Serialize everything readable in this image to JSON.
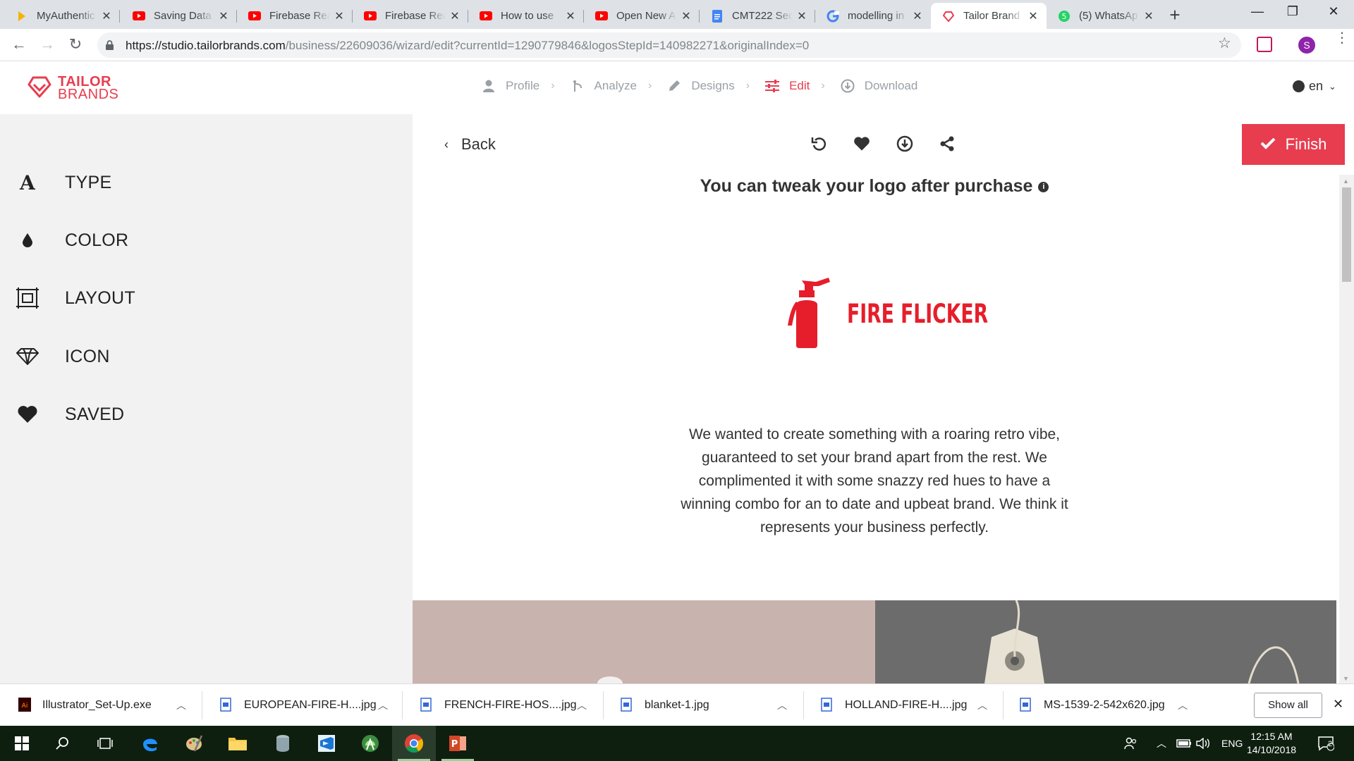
{
  "browser": {
    "tabs": [
      {
        "title": "MyAuthentic",
        "favicon": "myauthentic-icon",
        "color": "#f4b400"
      },
      {
        "title": "Saving Data",
        "favicon": "youtube-icon",
        "color": "#ff0000"
      },
      {
        "title": "Firebase Rea",
        "favicon": "youtube-icon",
        "color": "#ff0000"
      },
      {
        "title": "Firebase Rea",
        "favicon": "youtube-icon",
        "color": "#ff0000"
      },
      {
        "title": "How to use",
        "favicon": "youtube-icon",
        "color": "#ff0000"
      },
      {
        "title": "Open New A",
        "favicon": "youtube-icon",
        "color": "#ff0000"
      },
      {
        "title": "CMT222 Sec",
        "favicon": "docs-icon",
        "color": "#4285f4"
      },
      {
        "title": "modelling in",
        "favicon": "google-icon",
        "color": "#4285f4"
      },
      {
        "title": "Tailor Brand",
        "favicon": "tailorbrands-icon",
        "color": "#e73d4f",
        "active": true
      },
      {
        "title": "(5) WhatsAp",
        "favicon": "whatsapp-icon",
        "color": "#25d366"
      }
    ],
    "url_host": "https://studio.tailorbrands.com",
    "url_path": "/business/22609036/wizard/edit?currentId=1290779846&logosStepId=140982271&originalIndex=0",
    "profile_initial": "S"
  },
  "header": {
    "brand_line1": "TAILOR",
    "brand_line2": "BRANDS",
    "steps": [
      {
        "label": "Profile",
        "icon": "user-icon"
      },
      {
        "label": "Analyze",
        "icon": "analyze-icon"
      },
      {
        "label": "Designs",
        "icon": "pencil-icon"
      },
      {
        "label": "Edit",
        "icon": "sliders-icon",
        "current": true
      },
      {
        "label": "Download",
        "icon": "download-icon"
      }
    ],
    "language": "en"
  },
  "sidebar": {
    "items": [
      {
        "label": "TYPE",
        "icon": "type-icon"
      },
      {
        "label": "COLOR",
        "icon": "drop-icon"
      },
      {
        "label": "LAYOUT",
        "icon": "layout-icon"
      },
      {
        "label": "ICON",
        "icon": "diamond-icon"
      },
      {
        "label": "SAVED",
        "icon": "heart-icon"
      }
    ]
  },
  "editor": {
    "back_label": "Back",
    "finish_label": "Finish",
    "headline": "You can tweak your logo after purchase",
    "logo_text": "FIRE FLICKER",
    "description": "We wanted to create something with a roaring retro vibe, guaranteed to set your brand apart from the rest. We complimented it with some snazzy red hues to have a winning combo for an to date and upbeat brand. We think it represents your business perfectly.",
    "accent_color": "#e73d4f",
    "logo_color": "#e61e2b"
  },
  "downloads": {
    "items": [
      "Illustrator_Set-Up.exe",
      "EUROPEAN-FIRE-H....jpg",
      "FRENCH-FIRE-HOS....jpg",
      "blanket-1.jpg",
      "HOLLAND-FIRE-H....jpg",
      "MS-1539-2-542x620.jpg"
    ],
    "show_all": "Show all"
  },
  "taskbar": {
    "language": "ENG",
    "time": "12:15 AM",
    "date": "14/10/2018",
    "notifications": "2"
  }
}
